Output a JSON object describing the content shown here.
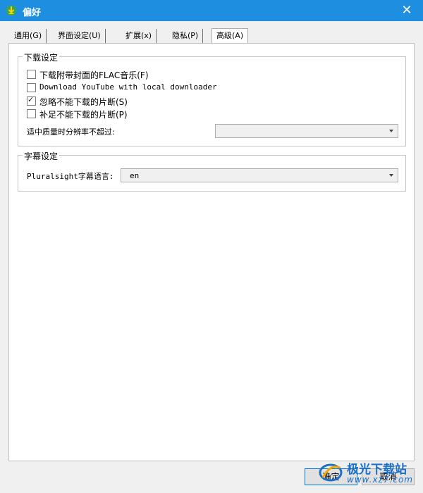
{
  "window": {
    "title": "偏好",
    "close_symbol": "✕"
  },
  "tabs": [
    {
      "label": "通用(G)",
      "active": false
    },
    {
      "label": "界面设定(U)",
      "active": false
    },
    {
      "label": "扩展(x)",
      "active": false
    },
    {
      "label": "隐私(P)",
      "active": false
    },
    {
      "label": "高级(A)",
      "active": true
    }
  ],
  "download_group": {
    "title": "下载设定",
    "options": [
      {
        "label": "下载附带封面的FLAC音乐(F)",
        "checked": false
      },
      {
        "label": "Download YouTube with local downloader",
        "checked": false
      },
      {
        "label": "忽略不能下载的片断(S)",
        "checked": true
      },
      {
        "label": "补足不能下载的片断(P)",
        "checked": false
      }
    ],
    "resolution_label": "适中质量时分辨率不超过:",
    "resolution_value": ""
  },
  "subtitle_group": {
    "title": "字幕设定",
    "language_label": "Pluralsight字幕语言:",
    "language_value": "en"
  },
  "buttons": {
    "ok": "确定",
    "cancel": "取消"
  },
  "watermark": {
    "name": "极光下载站",
    "url": "www.xz7.com"
  },
  "colors": {
    "titlebar": "#1e8fe0",
    "watermark": "#1e6fc7"
  }
}
